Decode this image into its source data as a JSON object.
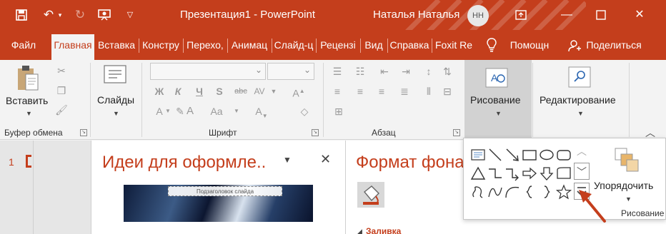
{
  "window": {
    "title": "Презентация1  -  PowerPoint",
    "user_name": "Наталья Наталья",
    "user_initials": "НН",
    "colors": {
      "accent": "#c43e1c",
      "ribbon": "#f3f3f3"
    }
  },
  "tabs": [
    "Файл",
    "Главная",
    "Вставка",
    "Констру",
    "Перехо,",
    "Анимац",
    "Слайд-ц",
    "Рецензі",
    "Вид",
    "Справка",
    "Foxit Re",
    "Помощн",
    "Поделиться"
  ],
  "active_tab": "Главная",
  "ribbon": {
    "clipboard": {
      "paste_label": "Вставить",
      "group_label": "Буфер обмена"
    },
    "slides": {
      "label": "Слайды"
    },
    "font": {
      "group_label": "Шрифт",
      "bold": "Ж",
      "italic": "К",
      "underline": "Ч",
      "strike": "S",
      "clear_format": "abc"
    },
    "paragraph": {
      "group_label": "Абзац"
    },
    "drawing": {
      "label": "Рисование"
    },
    "editing": {
      "label": "Редактирование"
    }
  },
  "slide_panel": {
    "slide_number": "1"
  },
  "design_ideas": {
    "title": "Идеи для оформле..",
    "thumb_subtitle": "Подзаголовок слайда"
  },
  "format_background": {
    "title": "Формат фона",
    "section_label": "Заливка"
  },
  "shapes_gallery": {
    "arrange_label": "Упорядочить",
    "group_label": "Рисование",
    "shapes": [
      "text-box",
      "line",
      "arrow-line",
      "rectangle",
      "oval",
      "rounded-rectangle",
      "triangle",
      "elbow-connector",
      "curved-connector",
      "right-arrow",
      "down-arrow",
      "flowchart-shape",
      "freeform",
      "curve",
      "arc",
      "left-brace",
      "right-brace",
      "star"
    ]
  }
}
